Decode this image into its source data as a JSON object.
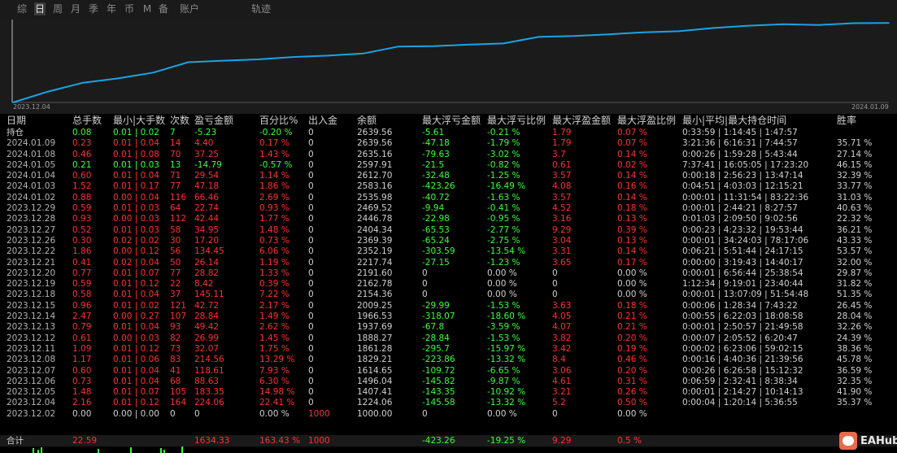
{
  "tabs": [
    {
      "label": "综"
    },
    {
      "label": "日",
      "active": true
    },
    {
      "label": "周"
    },
    {
      "label": "月"
    },
    {
      "label": "季"
    },
    {
      "label": "年"
    },
    {
      "label": "币"
    },
    {
      "label": "M"
    },
    {
      "label": "备"
    },
    {
      "label": "账户"
    },
    {
      "label": "轨迹"
    }
  ],
  "chart_data": {
    "type": "line",
    "x": [
      "2023.12.04",
      "2023.12.05",
      "2023.12.06",
      "2023.12.07",
      "2023.12.08",
      "2023.12.11",
      "2023.12.12",
      "2023.12.13",
      "2023.12.14",
      "2023.12.15",
      "2023.12.18",
      "2023.12.19",
      "2023.12.20",
      "2023.12.21",
      "2023.12.22",
      "2023.12.26",
      "2023.12.27",
      "2023.12.28",
      "2023.12.29",
      "2024.01.02",
      "2024.01.03",
      "2024.01.04",
      "2024.01.05",
      "2024.01.08",
      "2024.01.09"
    ],
    "x_start_label": "2023.12.04",
    "x_end_label": "2024.01.09",
    "values": [
      1000.0,
      1224.06,
      1407.41,
      1496.04,
      1614.65,
      1829.21,
      1861.28,
      1888.27,
      1937.69,
      1966.53,
      2009.25,
      2154.36,
      2162.78,
      2191.6,
      2217.74,
      2352.19,
      2369.39,
      2404.34,
      2446.78,
      2469.52,
      2535.98,
      2583.16,
      2612.7,
      2597.91,
      2635.16,
      2639.56
    ],
    "line_color": "#1aa3e6"
  },
  "table": {
    "headers": [
      "日期",
      "总手数",
      "最小|大手数",
      "次数",
      "盈亏金额",
      "百分比%",
      "出入金",
      "余额",
      "最大浮亏金额",
      "最大浮亏比例",
      "最大浮盈金额",
      "最大浮盈比例",
      "最小|平均|最大持仓时间",
      "胜率"
    ],
    "rows": [
      {
        "c": [
          "持仓",
          "0.08",
          "0.01 | 0.02",
          "7",
          "-5.23",
          "-0.20 %",
          "0",
          "2639.56",
          "-5.61",
          "-0.21 %",
          "1.79",
          "0.07 %",
          "0:33:59 | 1:14:45 | 1:47:57",
          ""
        ],
        "k": [
          "w",
          "g",
          "g",
          "g",
          "g",
          "g",
          "w",
          "w",
          "g",
          "g",
          "r",
          "r",
          "w",
          "w"
        ]
      },
      {
        "c": [
          "2024.01.09",
          "0.23",
          "0.01 | 0.04",
          "14",
          "4.40",
          "0.17 %",
          "0",
          "2639.56",
          "-47.18",
          "-1.79 %",
          "1.79",
          "0.07 %",
          "3:21:36 | 6:16:31 | 7:44:57",
          "35.71 %"
        ],
        "k": [
          "gr",
          "r",
          "r",
          "r",
          "r",
          "r",
          "w",
          "w",
          "g",
          "g",
          "r",
          "r",
          "w",
          "w"
        ]
      },
      {
        "c": [
          "2024.01.08",
          "0.46",
          "0.01 | 0.08",
          "70",
          "37.25",
          "1.43 %",
          "0",
          "2635.16",
          "-79.63",
          "-3.02 %",
          "3.7",
          "0.14 %",
          "0:00:26 | 1:59:28 | 5:43:44",
          "27.14 %"
        ],
        "k": [
          "gr",
          "r",
          "r",
          "r",
          "r",
          "r",
          "w",
          "w",
          "g",
          "g",
          "r",
          "r",
          "w",
          "w"
        ]
      },
      {
        "c": [
          "2024.01.05",
          "0.21",
          "0.01 | 0.03",
          "13",
          "-14.79",
          "-0.57 %",
          "0",
          "2597.91",
          "-21.5",
          "-0.82 %",
          "0.61",
          "0.02 %",
          "7:37:41 | 16:05:05 | 17:23:20",
          "46.15 %"
        ],
        "k": [
          "gr",
          "g",
          "g",
          "g",
          "g",
          "g",
          "w",
          "w",
          "g",
          "g",
          "r",
          "r",
          "w",
          "w"
        ]
      },
      {
        "c": [
          "2024.01.04",
          "0.60",
          "0.01 | 0.04",
          "71",
          "29.54",
          "1.14 %",
          "0",
          "2612.70",
          "-32.48",
          "-1.25 %",
          "3.57",
          "0.14 %",
          "0:00:18 | 2:56:23 | 13:47:14",
          "32.39 %"
        ],
        "k": [
          "gr",
          "r",
          "r",
          "r",
          "r",
          "r",
          "w",
          "w",
          "g",
          "g",
          "r",
          "r",
          "w",
          "w"
        ]
      },
      {
        "c": [
          "2024.01.03",
          "1.52",
          "0.01 | 0.17",
          "77",
          "47.18",
          "1.86 %",
          "0",
          "2583.16",
          "-423.26",
          "-16.49 %",
          "4.08",
          "0.16 %",
          "0:04:51 | 4:03:03 | 12:15:21",
          "33.77 %"
        ],
        "k": [
          "gr",
          "r",
          "r",
          "r",
          "r",
          "r",
          "w",
          "w",
          "g",
          "g",
          "r",
          "r",
          "w",
          "w"
        ]
      },
      {
        "c": [
          "2024.01.02",
          "0.88",
          "0.00 | 0.04",
          "116",
          "66.46",
          "2.69 %",
          "0",
          "2535.98",
          "-40.72",
          "-1.63 %",
          "3.57",
          "0.14 %",
          "0:00:01 | 11:31:54 | 83:22:36",
          "31.03 %"
        ],
        "k": [
          "gr",
          "r",
          "r",
          "r",
          "r",
          "r",
          "w",
          "w",
          "g",
          "g",
          "r",
          "r",
          "w",
          "w"
        ]
      },
      {
        "c": [
          "2023.12.29",
          "0.59",
          "0.01 | 0.03",
          "64",
          "22.74",
          "0.93 %",
          "0",
          "2469.52",
          "-9.94",
          "-0.41 %",
          "4.52",
          "0.18 %",
          "0:00:01 | 2:44:21 | 8:27:57",
          "40.63 %"
        ],
        "k": [
          "gr",
          "r",
          "r",
          "r",
          "r",
          "r",
          "w",
          "w",
          "g",
          "g",
          "r",
          "r",
          "w",
          "w"
        ]
      },
      {
        "c": [
          "2023.12.28",
          "0.93",
          "0.00 | 0.03",
          "112",
          "42.44",
          "1.77 %",
          "0",
          "2446.78",
          "-22.98",
          "-0.95 %",
          "3.16",
          "0.13 %",
          "0:01:03 | 2:09:50 | 9:02:56",
          "22.32 %"
        ],
        "k": [
          "gr",
          "r",
          "r",
          "r",
          "r",
          "r",
          "w",
          "w",
          "g",
          "g",
          "r",
          "r",
          "w",
          "w"
        ]
      },
      {
        "c": [
          "2023.12.27",
          "0.52",
          "0.01 | 0.03",
          "58",
          "34.95",
          "1.48 %",
          "0",
          "2404.34",
          "-65.53",
          "-2.77 %",
          "9.29",
          "0.39 %",
          "0:00:23 | 4:23:32 | 19:53:44",
          "36.21 %"
        ],
        "k": [
          "gr",
          "r",
          "r",
          "r",
          "r",
          "r",
          "w",
          "w",
          "g",
          "g",
          "r",
          "r",
          "w",
          "w"
        ]
      },
      {
        "c": [
          "2023.12.26",
          "0.30",
          "0.02 | 0.02",
          "30",
          "17.20",
          "0.73 %",
          "0",
          "2369.39",
          "-65.24",
          "-2.75 %",
          "3.04",
          "0.13 %",
          "0:00:01 | 34:24:03 | 78:17:06",
          "43.33 %"
        ],
        "k": [
          "gr",
          "r",
          "r",
          "r",
          "r",
          "r",
          "w",
          "w",
          "g",
          "g",
          "r",
          "r",
          "w",
          "w"
        ]
      },
      {
        "c": [
          "2023.12.22",
          "1.86",
          "0.00 | 0.12",
          "56",
          "134.45",
          "6.06 %",
          "0",
          "2352.19",
          "-303.59",
          "-13.54 %",
          "3.31",
          "0.14 %",
          "0:06:21 | 5:51:44 | 24:17:15",
          "53.57 %"
        ],
        "k": [
          "gr",
          "r",
          "r",
          "r",
          "r",
          "r",
          "w",
          "w",
          "g",
          "g",
          "r",
          "r",
          "w",
          "w"
        ]
      },
      {
        "c": [
          "2023.12.21",
          "0.41",
          "0.02 | 0.04",
          "50",
          "26.14",
          "1.19 %",
          "0",
          "2217.74",
          "-27.15",
          "-1.23 %",
          "3.65",
          "0.17 %",
          "0:00:00 | 3:19:43 | 14:40:17",
          "32.00 %"
        ],
        "k": [
          "gr",
          "r",
          "r",
          "r",
          "r",
          "r",
          "w",
          "w",
          "g",
          "g",
          "r",
          "r",
          "w",
          "w"
        ]
      },
      {
        "c": [
          "2023.12.20",
          "0.77",
          "0.01 | 0.07",
          "77",
          "28.82",
          "1.33 %",
          "0",
          "2191.60",
          "0",
          "0.00 %",
          "0",
          "0.00 %",
          "0:00:01 | 6:56:44 | 25:38:54",
          "29.87 %"
        ],
        "k": [
          "gr",
          "r",
          "r",
          "r",
          "r",
          "r",
          "w",
          "w",
          "w",
          "w",
          "w",
          "w",
          "w",
          "w"
        ]
      },
      {
        "c": [
          "2023.12.19",
          "0.59",
          "0.01 | 0.12",
          "22",
          "8.42",
          "0.39 %",
          "0",
          "2162.78",
          "0",
          "0.00 %",
          "0",
          "0.00 %",
          "1:12:34 | 9:19:01 | 23:40:44",
          "31.82 %"
        ],
        "k": [
          "gr",
          "r",
          "r",
          "r",
          "r",
          "r",
          "w",
          "w",
          "w",
          "w",
          "w",
          "w",
          "w",
          "w"
        ]
      },
      {
        "c": [
          "2023.12.18",
          "0.58",
          "0.01 | 0.04",
          "37",
          "145.11",
          "7.22 %",
          "0",
          "2154.36",
          "0",
          "0.00 %",
          "0",
          "0.00 %",
          "0:00:01 | 13:07:09 | 51:54:48",
          "51.35 %"
        ],
        "k": [
          "gr",
          "r",
          "r",
          "r",
          "r",
          "r",
          "w",
          "w",
          "w",
          "w",
          "w",
          "w",
          "w",
          "w"
        ]
      },
      {
        "c": [
          "2023.12.15",
          "0.96",
          "0.01 | 0.02",
          "121",
          "42.72",
          "2.17 %",
          "0",
          "2009.25",
          "-29.99",
          "-1.53 %",
          "3.63",
          "0.18 %",
          "0:00:06 | 1:28:34 | 7:43:22",
          "26.45 %"
        ],
        "k": [
          "gr",
          "r",
          "r",
          "r",
          "r",
          "r",
          "w",
          "w",
          "g",
          "g",
          "r",
          "r",
          "w",
          "w"
        ]
      },
      {
        "c": [
          "2023.12.14",
          "2.47",
          "0.00 | 0.27",
          "107",
          "28.84",
          "1.49 %",
          "0",
          "1966.53",
          "-318.07",
          "-18.60 %",
          "4.05",
          "0.21 %",
          "0:00:55 | 6:22:03 | 18:08:58",
          "28.04 %"
        ],
        "k": [
          "gr",
          "r",
          "r",
          "r",
          "r",
          "r",
          "w",
          "w",
          "g",
          "g",
          "r",
          "r",
          "w",
          "w"
        ]
      },
      {
        "c": [
          "2023.12.13",
          "0.79",
          "0.01 | 0.04",
          "93",
          "49.42",
          "2.62 %",
          "0",
          "1937.69",
          "-67.8",
          "-3.59 %",
          "4.07",
          "0.21 %",
          "0:00:01 | 2:50:57 | 21:49:58",
          "32.26 %"
        ],
        "k": [
          "gr",
          "r",
          "r",
          "r",
          "r",
          "r",
          "w",
          "w",
          "g",
          "g",
          "r",
          "r",
          "w",
          "w"
        ]
      },
      {
        "c": [
          "2023.12.12",
          "0.61",
          "0.00 | 0.03",
          "82",
          "26.99",
          "1.45 %",
          "0",
          "1888.27",
          "-28.84",
          "-1.53 %",
          "3.82",
          "0.20 %",
          "0:00:07 | 2:05:52 | 6:20:47",
          "24.39 %"
        ],
        "k": [
          "gr",
          "r",
          "r",
          "r",
          "r",
          "r",
          "w",
          "w",
          "g",
          "g",
          "r",
          "r",
          "w",
          "w"
        ]
      },
      {
        "c": [
          "2023.12.11",
          "1.09",
          "0.01 | 0.12",
          "73",
          "32.07",
          "1.75 %",
          "0",
          "1861.28",
          "-295.7",
          "-15.97 %",
          "3.42",
          "0.19 %",
          "0:00:02 | 6:23:06 | 59:02:15",
          "38.36 %"
        ],
        "k": [
          "gr",
          "r",
          "r",
          "r",
          "r",
          "r",
          "w",
          "w",
          "g",
          "g",
          "r",
          "r",
          "w",
          "w"
        ]
      },
      {
        "c": [
          "2023.12.08",
          "1.17",
          "0.01 | 0.06",
          "83",
          "214.56",
          "13.29 %",
          "0",
          "1829.21",
          "-223.86",
          "-13.32 %",
          "8.4",
          "0.46 %",
          "0:00:16 | 4:40:36 | 21:39:56",
          "45.78 %"
        ],
        "k": [
          "gr",
          "r",
          "r",
          "r",
          "r",
          "r",
          "w",
          "w",
          "g",
          "g",
          "r",
          "r",
          "w",
          "w"
        ]
      },
      {
        "c": [
          "2023.12.07",
          "0.60",
          "0.01 | 0.04",
          "41",
          "118.61",
          "7.93 %",
          "0",
          "1614.65",
          "-109.72",
          "-6.65 %",
          "3.06",
          "0.20 %",
          "0:00:26 | 6:26:58 | 15:12:32",
          "36.59 %"
        ],
        "k": [
          "gr",
          "r",
          "r",
          "r",
          "r",
          "r",
          "w",
          "w",
          "g",
          "g",
          "r",
          "r",
          "w",
          "w"
        ]
      },
      {
        "c": [
          "2023.12.06",
          "0.73",
          "0.01 | 0.04",
          "68",
          "88.63",
          "6.30 %",
          "0",
          "1496.04",
          "-145.82",
          "-9.87 %",
          "4.61",
          "0.31 %",
          "0:06:59 | 2:32:41 | 8:38:34",
          "32.35 %"
        ],
        "k": [
          "gr",
          "r",
          "r",
          "r",
          "r",
          "r",
          "w",
          "w",
          "g",
          "g",
          "r",
          "r",
          "w",
          "w"
        ]
      },
      {
        "c": [
          "2023.12.05",
          "1.48",
          "0.01 | 0.07",
          "105",
          "183.35",
          "14.98 %",
          "0",
          "1407.41",
          "-143.35",
          "-10.92 %",
          "3.21",
          "0.26 %",
          "0:00:01 | 2:14:27 | 10:14:13",
          "41.90 %"
        ],
        "k": [
          "gr",
          "r",
          "r",
          "r",
          "r",
          "r",
          "w",
          "w",
          "g",
          "g",
          "r",
          "r",
          "w",
          "w"
        ]
      },
      {
        "c": [
          "2023.12.04",
          "2.16",
          "0.01 | 0.12",
          "164",
          "224.06",
          "22.41 %",
          "0",
          "1224.06",
          "-145.58",
          "-13.32 %",
          "5.2",
          "0.50 %",
          "0:00:04 | 1:20:14 | 5:36:55",
          "35.37 %"
        ],
        "k": [
          "gr",
          "r",
          "r",
          "r",
          "r",
          "r",
          "w",
          "w",
          "g",
          "g",
          "r",
          "r",
          "w",
          "w"
        ]
      },
      {
        "c": [
          "2023.12.02",
          "0.00",
          "0.00 | 0.00",
          "0",
          "0",
          "0.00 %",
          "1000",
          "1000.00",
          "0",
          "0.00 %",
          "0",
          "0.00 %",
          "",
          ""
        ],
        "k": [
          "gr",
          "w",
          "w",
          "w",
          "w",
          "w",
          "r",
          "w",
          "w",
          "w",
          "w",
          "w",
          "w",
          "w"
        ]
      }
    ],
    "total": {
      "c": [
        "合计",
        "22.59",
        "",
        "",
        "1634.33",
        "163.43 %",
        "1000",
        "",
        "-423.26",
        "-19.25 %",
        "9.29",
        "0.5 %",
        "",
        ""
      ],
      "k": [
        "w",
        "r",
        "w",
        "w",
        "r",
        "r",
        "r",
        "w",
        "g",
        "g",
        "r",
        "r",
        "w",
        "w"
      ]
    }
  },
  "logo_text": "EAHub"
}
